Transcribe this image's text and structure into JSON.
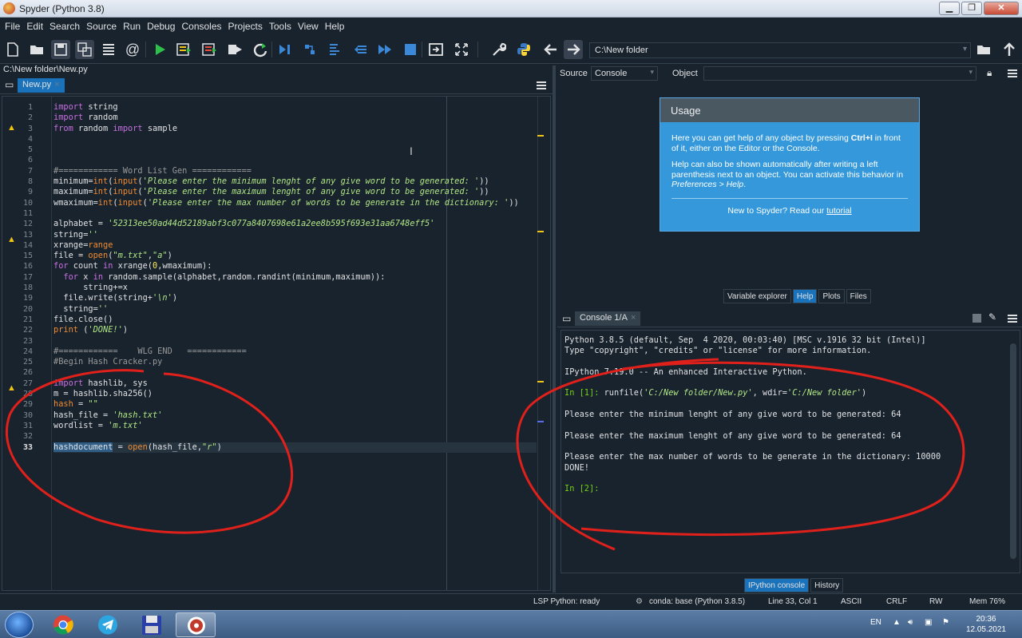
{
  "window": {
    "title": "Spyder (Python 3.8)"
  },
  "menu": [
    "File",
    "Edit",
    "Search",
    "Source",
    "Run",
    "Debug",
    "Consoles",
    "Projects",
    "Tools",
    "View",
    "Help"
  ],
  "toolbar": {
    "path": "C:\\New folder"
  },
  "editor": {
    "file_path": "C:\\New folder\\New.py",
    "tab_label": "New.py",
    "line_numbers": [
      "1",
      "2",
      "3",
      "4",
      "5",
      "6",
      "7",
      "8",
      "9",
      "10",
      "11",
      "12",
      "13",
      "14",
      "15",
      "16",
      "17",
      "18",
      "19",
      "20",
      "21",
      "22",
      "23",
      "24",
      "25",
      "26",
      "27",
      "28",
      "29",
      "30",
      "31",
      "32",
      "33"
    ],
    "warning_lines": [
      3,
      13,
      27
    ],
    "current_line": 33
  },
  "help": {
    "source_label": "Source",
    "source_value": "Console",
    "object_label": "Object",
    "usage_title": "Usage",
    "usage_p1_a": "Here you can get help of any object by pressing ",
    "usage_p1_key": "Ctrl+I",
    "usage_p1_b": " in front of it, either on the Editor or the Console.",
    "usage_p2_a": "Help can also be shown automatically after writing a left parenthesis next to an object. You can activate this behavior in ",
    "usage_p2_link": "Preferences > Help",
    "usage_p2_b": ".",
    "footer_text": "New to Spyder? Read our ",
    "footer_link": "tutorial",
    "tabs": [
      "Variable explorer",
      "Help",
      "Plots",
      "Files"
    ]
  },
  "console": {
    "tab_label": "Console 1/A",
    "line1": "Python 3.8.5 (default, Sep  4 2020, 00:03:40) [MSC v.1916 32 bit (Intel)]",
    "line2": "Type \"copyright\", \"credits\" or \"license\" for more information.",
    "line3": "IPython 7.19.0 -- An enhanced Interactive Python.",
    "prompt1": "In [1]: ",
    "cmd1_a": "runfile(",
    "cmd1_s1": "'C:/New folder/New.py'",
    "cmd1_b": ", wdir=",
    "cmd1_s2": "'C:/New folder'",
    "cmd1_c": ")",
    "out1": "Please enter the minimum lenght of any give word to be generated: 64",
    "out2": "Please enter the maximum lenght of any give word to be generated: 64",
    "out3": "Please enter the max number of words to be generate in the dictionary: 10000",
    "out4": "DONE!",
    "prompt2": "In [2]:",
    "tabs": [
      "IPython console",
      "History"
    ]
  },
  "status": {
    "lsp": "LSP Python: ready",
    "conda": "conda: base (Python 3.8.5)",
    "position": "Line 33, Col 1",
    "encoding": "ASCII",
    "eol": "CRLF",
    "mode": "RW",
    "mem": "Mem 76%"
  },
  "taskbar": {
    "lang": "EN",
    "time": "20:36",
    "date": "12.05.2021"
  },
  "colors": {
    "background": "#19232d",
    "accent": "#1a72bb",
    "annotation": "#e0201b"
  }
}
